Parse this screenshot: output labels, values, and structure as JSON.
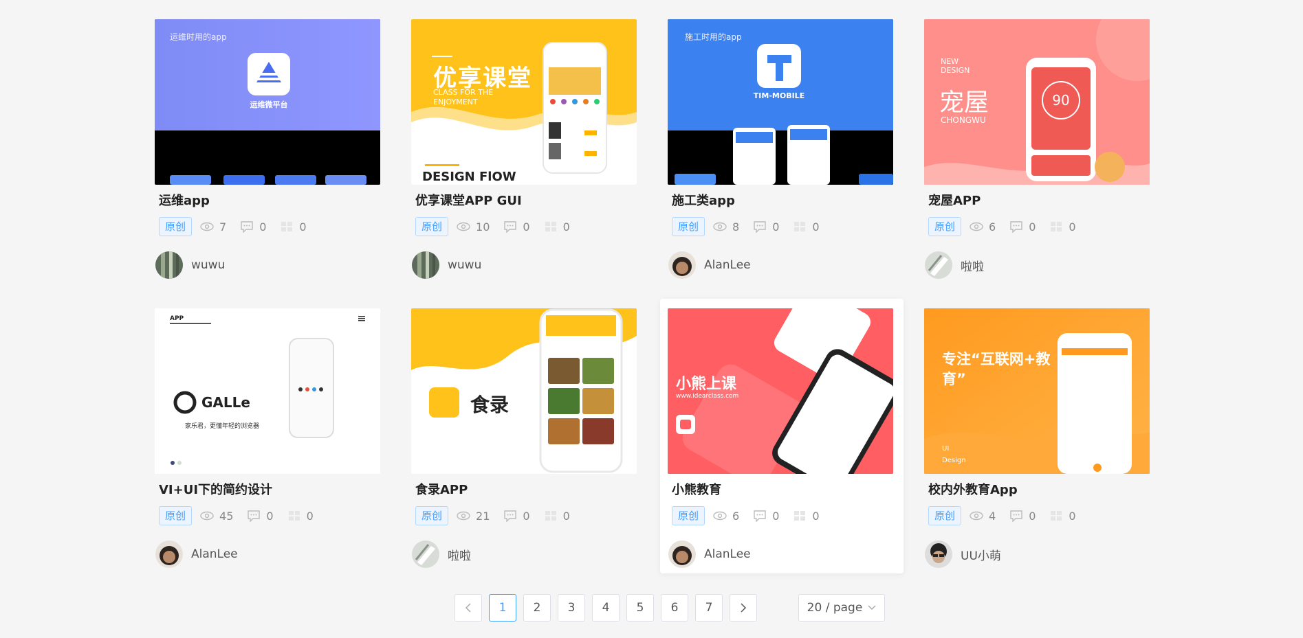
{
  "cards": [
    {
      "title": "运维app",
      "tag": "原创",
      "views": "7",
      "comments": "0",
      "likes": "0",
      "author": "wuwu",
      "cover_text": "运维时用的app",
      "cover_logo_text": "运维微平台"
    },
    {
      "title": "优享课堂APP GUI",
      "tag": "原创",
      "views": "10",
      "comments": "0",
      "likes": "0",
      "author": "wuwu",
      "cover_text": "优享课堂",
      "cover_sub": "CLASS FOR THE ENJOYMENT",
      "cover_bottom": "DESIGN FlOW"
    },
    {
      "title": "施工类app",
      "tag": "原创",
      "views": "8",
      "comments": "0",
      "likes": "0",
      "author": "AlanLee",
      "cover_text": "施工时用的app",
      "cover_logo_text": "TIM-MOBILE"
    },
    {
      "title": "宠屋APP",
      "tag": "原创",
      "views": "6",
      "comments": "0",
      "likes": "0",
      "author": "啦啦",
      "cover_text": "宠屋",
      "cover_sub": "CHONGWU",
      "cover_new": "NEW DESIGN"
    },
    {
      "title": "VI+UI下的简约设计",
      "tag": "原创",
      "views": "45",
      "comments": "0",
      "likes": "0",
      "author": "AlanLee",
      "cover_text": "GALLe",
      "cover_sub": "家乐君，更懂年轻的浏览器"
    },
    {
      "title": "食录APP",
      "tag": "原创",
      "views": "21",
      "comments": "0",
      "likes": "0",
      "author": "啦啦",
      "cover_text": "食录"
    },
    {
      "title": "小熊教育",
      "tag": "原创",
      "views": "6",
      "comments": "0",
      "likes": "0",
      "author": "AlanLee",
      "cover_text": "小熊上课",
      "cover_sub": "www.idearclass.com"
    },
    {
      "title": "校内外教育App",
      "tag": "原创",
      "views": "4",
      "comments": "0",
      "likes": "0",
      "author": "UU小萌",
      "cover_text": "专注“互联网+教育”",
      "cover_sub": "UI Design"
    }
  ],
  "pagination": {
    "pages": [
      "1",
      "2",
      "3",
      "4",
      "5",
      "6",
      "7"
    ],
    "current": "1",
    "page_size": "20 / page"
  },
  "colors": {
    "accent": "#409eff",
    "tag_bg": "#ecf5ff"
  }
}
